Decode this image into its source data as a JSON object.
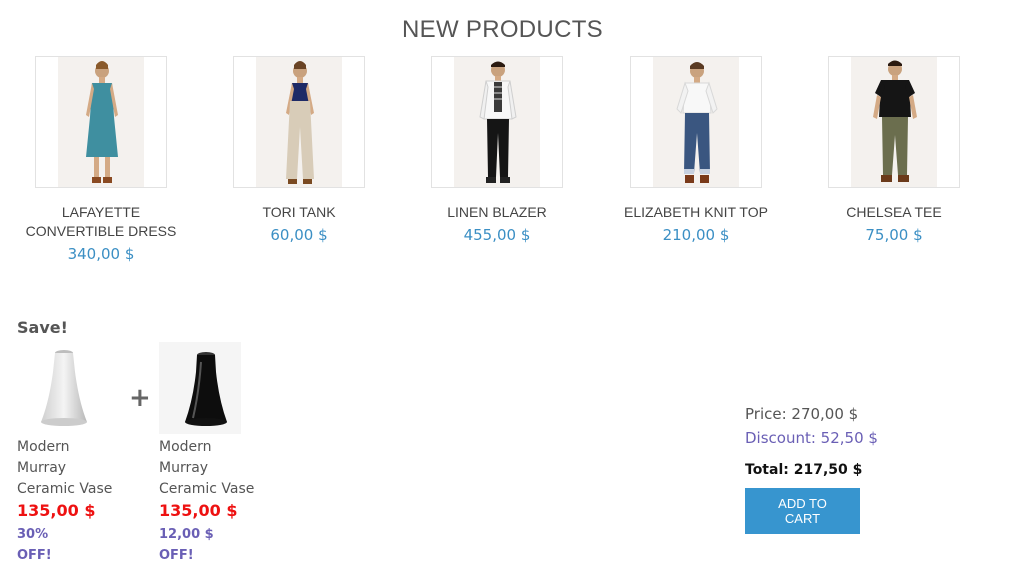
{
  "section": {
    "title": "NEW PRODUCTS"
  },
  "products": [
    {
      "name": "LAFAYETTE CONVERTIBLE DRESS",
      "price": "340,00 $",
      "image": "teal-dress-model"
    },
    {
      "name": "TORI TANK",
      "price": "60,00 $",
      "image": "navy-tank-beige-pants-model"
    },
    {
      "name": "LINEN BLAZER",
      "price": "455,00 $",
      "image": "white-blazer-model"
    },
    {
      "name": "ELIZABETH KNIT TOP",
      "price": "210,00 $",
      "image": "white-knit-top-model"
    },
    {
      "name": "CHELSEA TEE",
      "price": "75,00 $",
      "image": "black-tee-model"
    }
  ],
  "bundle": {
    "title": "Save!",
    "plus": "+",
    "items": [
      {
        "name": "Modern Murray Ceramic Vase",
        "price": "135,00 $",
        "discount": "30% OFF!",
        "image": "white-vase"
      },
      {
        "name": "Modern Murray Ceramic Vase",
        "price": "135,00 $",
        "discount": "12,00 $ OFF!",
        "image": "black-vase"
      }
    ],
    "summary": {
      "price": "Price: 270,00 $",
      "discount": "Discount: 52,50 $",
      "total": "Total: 217,50 $",
      "add_to_cart": "ADD TO CART"
    }
  },
  "colors": {
    "price": "#3b8fc4",
    "sale_price": "#ee1111",
    "discount": "#6a5fb5",
    "button": "#3795cf"
  }
}
